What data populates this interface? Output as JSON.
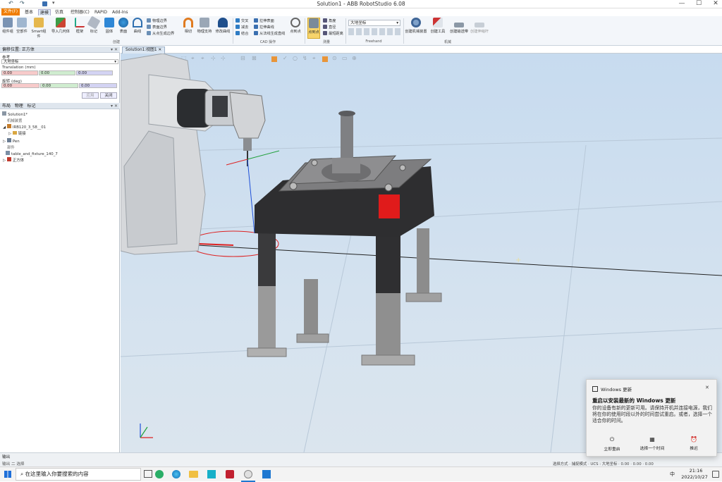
{
  "window": {
    "title": "Solution1 - ABB RobotStudio 6.08",
    "min": "—",
    "max": "☐",
    "close": "✕"
  },
  "quick_access": [
    "↶",
    "↷",
    "⚲",
    "▾"
  ],
  "tabs": [
    {
      "label": "文件(F)",
      "kind": "file"
    },
    {
      "label": "基本"
    },
    {
      "label": "建模",
      "active": true
    },
    {
      "label": "仿真"
    },
    {
      "label": "控制器(C)"
    },
    {
      "label": "RAPID"
    },
    {
      "label": "Add-Ins"
    }
  ],
  "ribbon": {
    "groups": {
      "create": "创建",
      "cad": "CAD 操作",
      "measure": "测量",
      "freehand": "Freehand",
      "mechanism": "机械"
    },
    "buttons": [
      "组件组",
      "空部件",
      "Smart组件",
      "导入几何体",
      "框架",
      "标记",
      "固体",
      "表面",
      "曲线",
      "相切",
      "物理支持",
      "修改曲线",
      "点到点",
      "角度",
      "直径",
      "最短距离",
      "创建机械装置",
      "创建工具",
      "创建输送带",
      "创建伸缩杆"
    ],
    "small_create": [
      "物理边界",
      "表面边界",
      "从点生成边界"
    ],
    "small_cad": [
      "交叉",
      "减去",
      "结合",
      "拉伸表面",
      "拉伸曲线",
      "从法线生成直线"
    ],
    "frame_dropdown": "大地坐标"
  },
  "left_panel": {
    "offset_title": "偏移位置: 正方体",
    "ref_label": "参考",
    "ref_value": "大地坐标",
    "translation_label": "Translation (mm)",
    "translation": [
      "0.00",
      "0.00",
      "0.00"
    ],
    "rotation_label": "旋转 (deg)",
    "rotation": [
      "0.00",
      "0.00",
      "0.00"
    ],
    "apply": "应用",
    "close": "关闭",
    "layout_tabs": [
      "布局",
      "物理",
      "标记"
    ],
    "tree": [
      {
        "text": "Solution1*",
        "indent": 0
      },
      {
        "text": "机械装置",
        "indent": 1
      },
      {
        "text": "IRB120_3_58__01",
        "indent": 1
      },
      {
        "text": "链接",
        "indent": 2
      },
      {
        "text": "Pen",
        "indent": 1
      },
      {
        "text": "部件",
        "indent": 1
      },
      {
        "text": "table_and_fixture_140_7",
        "indent": 1
      },
      {
        "text": "正方体",
        "indent": 1
      }
    ]
  },
  "viewport": {
    "tab_label": "Solution1:视图1",
    "tab_close": "✕"
  },
  "statusbar": {
    "output_title": "输出",
    "output_line": "输出 二 选择",
    "right": "选择方式 · 捕捉模式 · UCS : 大地坐标 · 0.00 · 0.00 · 0.00"
  },
  "taskbar": {
    "search_placeholder": "在这里输入你要搜索的内容",
    "time": "21:16",
    "date": "2022/10/27",
    "ime": "中"
  },
  "toast": {
    "app": "Windows 更新",
    "heading": "重启以安装最新的 Windows 更新",
    "body": "你的设备有新的更新可用。请保持开机并连接电源，我们将在你的使用时段以外的时间尝试重启。或者，选择一个适合你的时间。",
    "actions": [
      "立即重启",
      "选择一个时间",
      "推迟"
    ]
  },
  "colors": {
    "accent": "#0a62b6",
    "file_tab": "#f07d00",
    "toast_bg": "#f2f2f2"
  }
}
